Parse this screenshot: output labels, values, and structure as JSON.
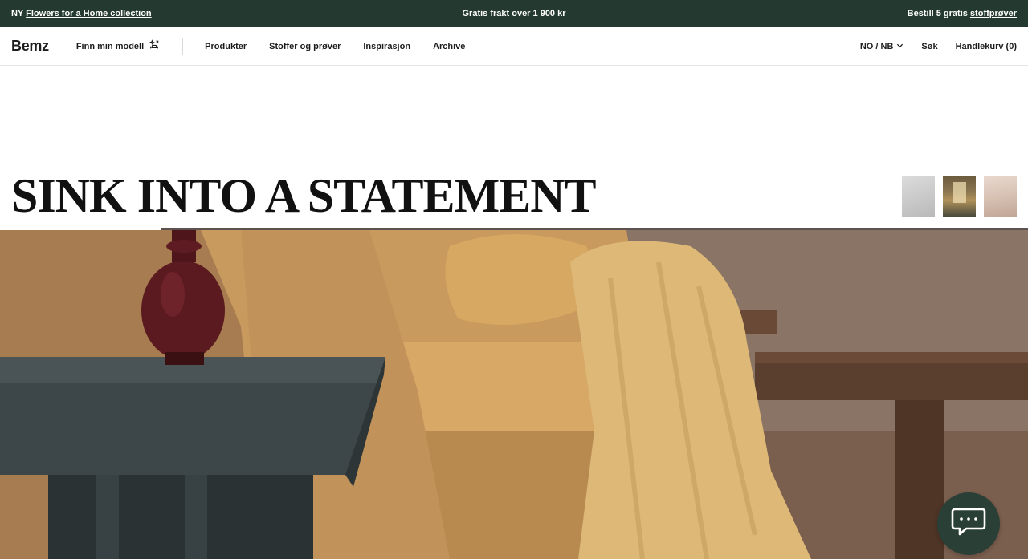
{
  "announcement": {
    "new_prefix": "NY",
    "new_link": "Flowers for a Home collection",
    "center_text": "Gratis frakt over 1 900 kr",
    "right_prefix": "Bestill 5 gratis",
    "right_link": "stoffprøver"
  },
  "nav": {
    "logo": "Bemz",
    "finn_modell": "Finn min modell",
    "links": [
      "Produkter",
      "Stoffer og prøver",
      "Inspirasjon",
      "Archive"
    ],
    "locale": "NO / NB",
    "search": "Søk",
    "cart": "Handlekurv (0)"
  },
  "hero": {
    "title": "SINK INTO A STATEMENT"
  },
  "colors": {
    "announce_bg": "#243a31",
    "chat_bg": "#2a3f36"
  },
  "icons": {
    "finn": "sparkle-sofa-icon",
    "locale": "chevron-down-icon",
    "chat": "chat-bubble-icon"
  }
}
